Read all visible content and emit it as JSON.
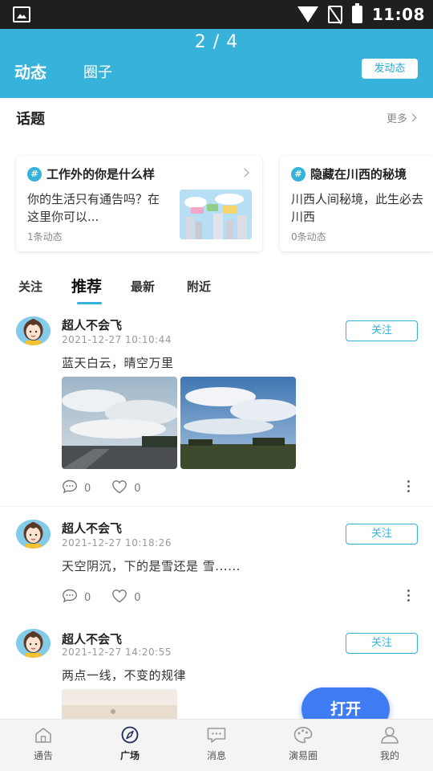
{
  "status_bar": {
    "time": "11:08",
    "icons": [
      "gallery-icon",
      "wifi-icon",
      "no-sim-icon",
      "battery-charging-icon"
    ]
  },
  "header": {
    "pager": "2 / 4",
    "tabs": [
      {
        "label": "动态",
        "active": true
      },
      {
        "label": "圈子",
        "active": false
      }
    ],
    "post_button": "发动态",
    "bg_color": "#36b2db"
  },
  "topics": {
    "title": "话题",
    "more_label": "更多",
    "cards": [
      {
        "title": "工作外的你是什么样",
        "desc": "你的生活只有通告吗？在这里你可以...",
        "count": "1条动态"
      },
      {
        "title": "隐藏在川西的秘境",
        "desc": "川西人间秘境，此生必去川西",
        "count": "0条动态"
      }
    ]
  },
  "feed_tabs": [
    {
      "label": "关注",
      "active": false
    },
    {
      "label": "推荐",
      "active": true
    },
    {
      "label": "最新",
      "active": false
    },
    {
      "label": "附近",
      "active": false
    }
  ],
  "posts": [
    {
      "user": "超人不会飞",
      "time": "2021-12-27 10:10:44",
      "follow_label": "关注",
      "text": "蓝天白云，晴空万里",
      "comments": "0",
      "likes": "0",
      "image_count": 2
    },
    {
      "user": "超人不会飞",
      "time": "2021-12-27 10:18:26",
      "follow_label": "关注",
      "text": "天空阴沉，下的是雪还是 雪......",
      "comments": "0",
      "likes": "0",
      "image_count": 0
    },
    {
      "user": "超人不会飞",
      "time": "2021-12-27 14:20:55",
      "follow_label": "关注",
      "text": "两点一线，不变的规律",
      "image_count": 1
    }
  ],
  "open_button": "打开",
  "bottom_nav": [
    {
      "label": "通告",
      "icon": "home-icon",
      "active": false
    },
    {
      "label": "广场",
      "icon": "compass-icon",
      "active": true
    },
    {
      "label": "消息",
      "icon": "message-icon",
      "active": false
    },
    {
      "label": "演易圈",
      "icon": "palette-icon",
      "active": false
    },
    {
      "label": "我的",
      "icon": "user-icon",
      "active": false
    }
  ]
}
